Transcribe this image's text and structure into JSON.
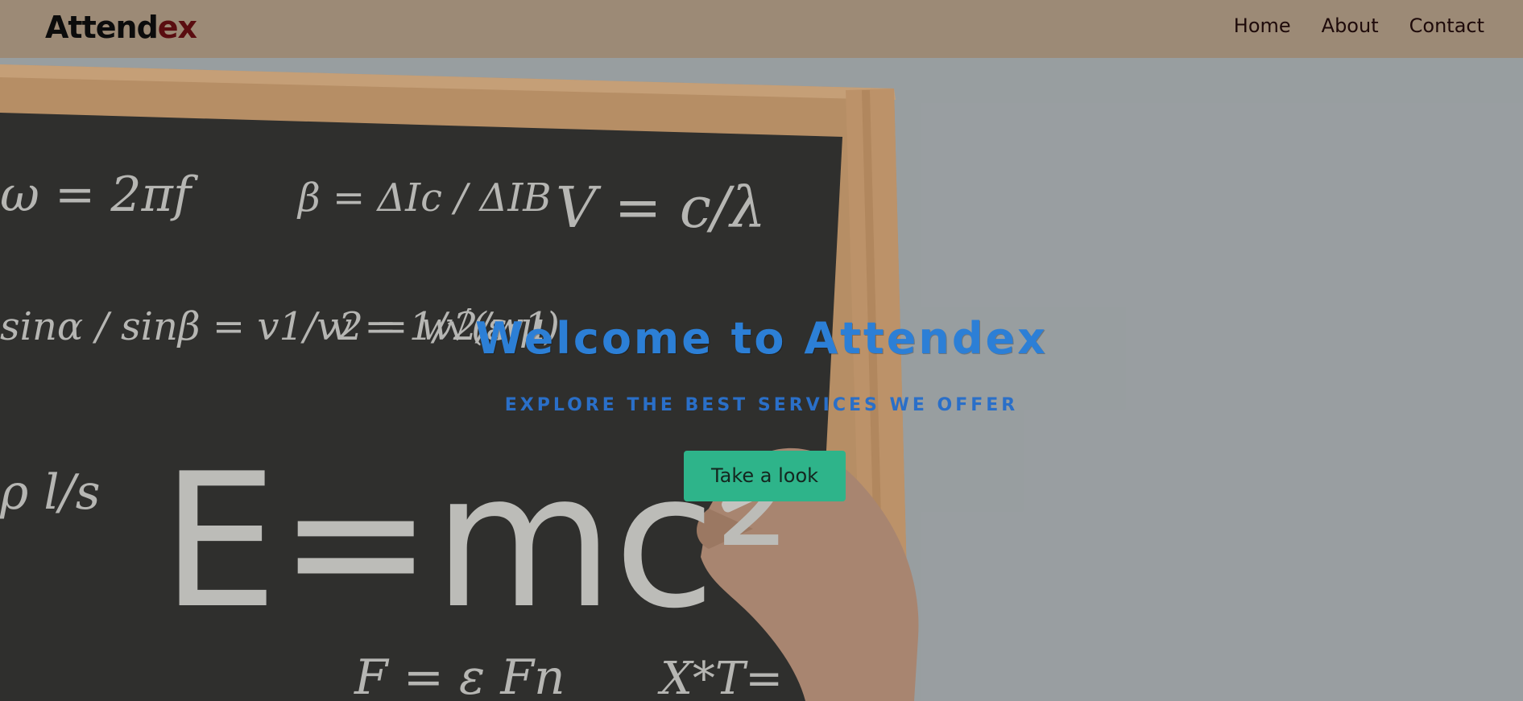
{
  "brand": {
    "part1": "Attend",
    "part2": "ex"
  },
  "nav": {
    "items": [
      {
        "label": "Home"
      },
      {
        "label": "About"
      },
      {
        "label": "Contact"
      }
    ]
  },
  "hero": {
    "title": "Welcome to Attendex",
    "subtitle": "EXPLORE THE BEST SERVICES WE OFFER",
    "cta_label": "Take a look",
    "background_image": "chalkboard-physics-equations-photo",
    "chalk_formulas": [
      "ω = 2πf",
      "β = ΔIc / ΔIB",
      "V = c/λ",
      "sinα / sinβ = v1/v2 = w2/w1",
      "v = 1/√(ε·μ)",
      "ρ l/s",
      "E=mc²",
      "F = ε Fn",
      "X*T="
    ]
  },
  "colors": {
    "navbar": "#9c8a76",
    "title": "#2c7fd6",
    "subtitle": "#2a6fc8",
    "button": "#2eb48a",
    "board": "#2e2e2c",
    "frame": "#c89a6c",
    "wall": "#a6acaf"
  }
}
